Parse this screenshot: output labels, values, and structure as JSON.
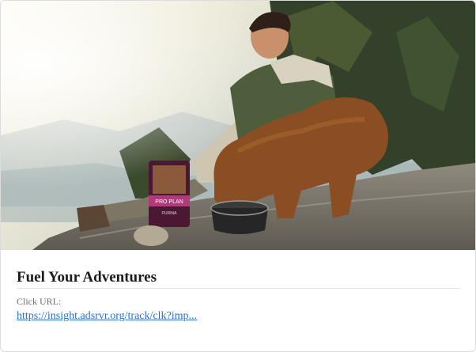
{
  "ad": {
    "image_alt": "Hiker on a rocky mountain ledge with a golden-brown dog eating from a bowl next to a bag of Purina Pro Plan dog food",
    "product_brand": "PRO PLAN",
    "product_maker": "PURINA",
    "title": "Fuel Your Adventures",
    "url_label": "Click URL:",
    "url_text": "https://insight.adsrvr.org/track/clk?imp..."
  }
}
